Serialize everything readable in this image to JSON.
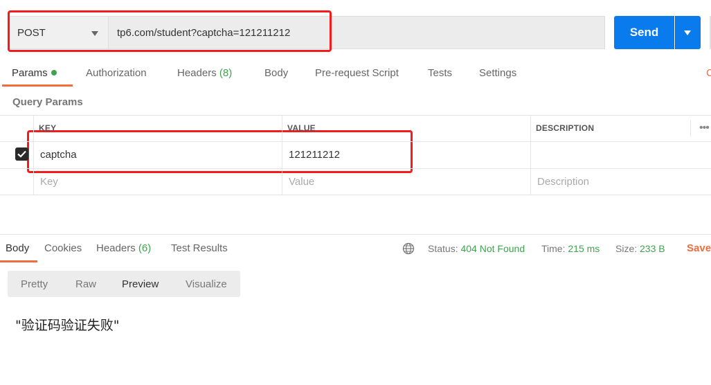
{
  "request": {
    "method": "POST",
    "url": "tp6.com/student?captcha=121211212",
    "send_label": "Send"
  },
  "request_tabs": [
    {
      "label": "Params",
      "active": true,
      "indicator": "green-dot"
    },
    {
      "label": "Authorization"
    },
    {
      "label": "Headers",
      "count": "(8)"
    },
    {
      "label": "Body"
    },
    {
      "label": "Pre-request Script"
    },
    {
      "label": "Tests"
    },
    {
      "label": "Settings"
    }
  ],
  "query_params": {
    "title": "Query Params",
    "columns": [
      "KEY",
      "VALUE",
      "DESCRIPTION"
    ],
    "rows": [
      {
        "checked": true,
        "key": "captcha",
        "value": "121211212",
        "description": ""
      }
    ],
    "new_row": {
      "key_placeholder": "Key",
      "value_placeholder": "Value",
      "description_placeholder": "Description"
    }
  },
  "response_tabs": [
    {
      "label": "Body",
      "active": true
    },
    {
      "label": "Cookies"
    },
    {
      "label": "Headers",
      "count": "(6)"
    },
    {
      "label": "Test Results"
    }
  ],
  "response_meta": {
    "status_label": "Status:",
    "status_value": "404 Not Found",
    "time_label": "Time:",
    "time_value": "215 ms",
    "size_label": "Size:",
    "size_value": "233 B",
    "save_label": "Save"
  },
  "view_modes": [
    "Pretty",
    "Raw",
    "Preview",
    "Visualize"
  ],
  "active_view_mode": "Preview",
  "response_body": "\"验证码验证失败\"",
  "colors": {
    "accent": "#f26b3a",
    "send": "#097bed",
    "success": "#3fa34d",
    "highlight": "#f21c1c"
  },
  "icons": [
    "chevron-down-icon",
    "check-icon",
    "more-horizontal-icon",
    "globe-icon"
  ]
}
